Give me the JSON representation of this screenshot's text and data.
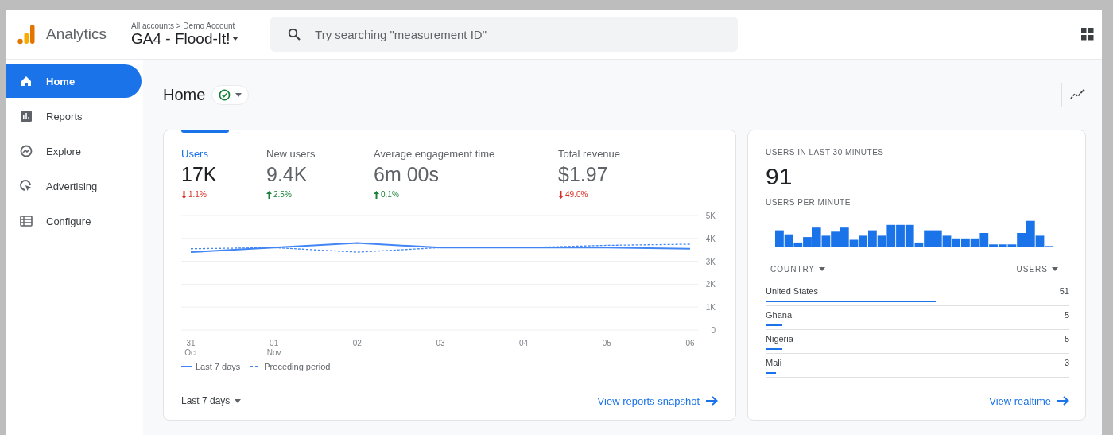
{
  "app": {
    "name": "Analytics"
  },
  "account": {
    "breadcrumb": "All accounts > Demo Account",
    "property": "GA4 - Flood-It!"
  },
  "search": {
    "placeholder": "Try searching \"measurement ID\""
  },
  "sidebar": {
    "items": [
      {
        "label": "Home",
        "kind": "home",
        "selected": true
      },
      {
        "label": "Reports",
        "kind": "reports",
        "selected": false
      },
      {
        "label": "Explore",
        "kind": "explore",
        "selected": false
      },
      {
        "label": "Advertising",
        "kind": "advertising",
        "selected": false
      },
      {
        "label": "Configure",
        "kind": "configure",
        "selected": false
      }
    ]
  },
  "page": {
    "title": "Home"
  },
  "overview": {
    "metrics": [
      {
        "label": "Users",
        "value": "17K",
        "change": "1.1%",
        "kind": "down",
        "selected": true
      },
      {
        "label": "New users",
        "value": "9.4K",
        "change": "2.5%",
        "kind": "up",
        "selected": false
      },
      {
        "label": "Average engagement time",
        "value": "6m 00s",
        "change": "0.1%",
        "kind": "up",
        "selected": false
      },
      {
        "label": "Total revenue",
        "value": "$1.97",
        "change": "49.0%",
        "kind": "down",
        "selected": false
      }
    ],
    "chart_data": {
      "type": "line",
      "categories": [
        "31 Oct",
        "01 Nov",
        "02",
        "03",
        "04",
        "05",
        "06"
      ],
      "grid": true,
      "legend": "bottom",
      "series": [
        {
          "name": "Last 7 days",
          "color": "#4285f4",
          "line_style": "solid",
          "values": [
            3400,
            3600,
            3800,
            3600,
            3600,
            3600,
            3550
          ]
        },
        {
          "name": "Preceding period",
          "color": "#4285f4",
          "line_style": "dashed",
          "values": [
            3550,
            3600,
            3400,
            3600,
            3600,
            3700,
            3750
          ]
        }
      ],
      "ylim": [
        0,
        5000
      ],
      "yticks": [
        {
          "value": 0,
          "label": "0"
        },
        {
          "value": 1000,
          "label": "1K"
        },
        {
          "value": 2000,
          "label": "2K"
        },
        {
          "value": 3000,
          "label": "3K"
        },
        {
          "value": 4000,
          "label": "4K"
        },
        {
          "value": 5000,
          "label": "5K"
        }
      ]
    },
    "range": "Last 7 days",
    "link": "View reports snapshot"
  },
  "realtime": {
    "title": "USERS IN LAST 30 MINUTES",
    "value": "91",
    "subtitle": "USERS PER MINUTE",
    "columns": [
      "COUNTRY",
      "USERS"
    ],
    "rows": [
      {
        "country": "United States",
        "users": "51",
        "level": 0.56
      },
      {
        "country": "Ghana",
        "users": "5",
        "level": 0.055
      },
      {
        "country": "Nigeria",
        "users": "5",
        "level": 0.055
      },
      {
        "country": "Mali",
        "users": "3",
        "level": 0.035
      }
    ],
    "link": "View realtime"
  }
}
